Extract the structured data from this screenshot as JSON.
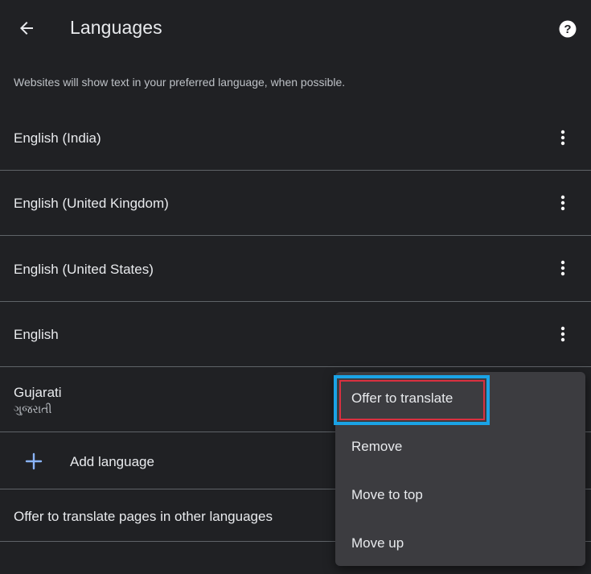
{
  "appbar": {
    "title": "Languages",
    "back_icon": "arrow-left-icon",
    "help_icon": "help-circle-icon"
  },
  "description": "Websites will show text in your preferred language, when possible.",
  "languages": [
    {
      "name": "English (India)",
      "native": ""
    },
    {
      "name": "English (United Kingdom)",
      "native": ""
    },
    {
      "name": "English (United States)",
      "native": ""
    },
    {
      "name": "English",
      "native": ""
    },
    {
      "name": "Gujarati",
      "native": "ગુજરાતી"
    }
  ],
  "add_language": {
    "label": "Add language",
    "icon": "plus-icon"
  },
  "offer_translate_row": {
    "label": "Offer to translate pages in other languages"
  },
  "context_menu": {
    "items": [
      {
        "label": "Offer to translate"
      },
      {
        "label": "Remove"
      },
      {
        "label": "Move to top"
      },
      {
        "label": "Move up"
      }
    ],
    "highlight_colors": {
      "outer": "#1aa3e6",
      "inner": "#d93040"
    }
  },
  "colors": {
    "background": "#202124",
    "menu": "#3c3c40",
    "accent": "#8ab4f8",
    "divider": "#5f6368"
  }
}
